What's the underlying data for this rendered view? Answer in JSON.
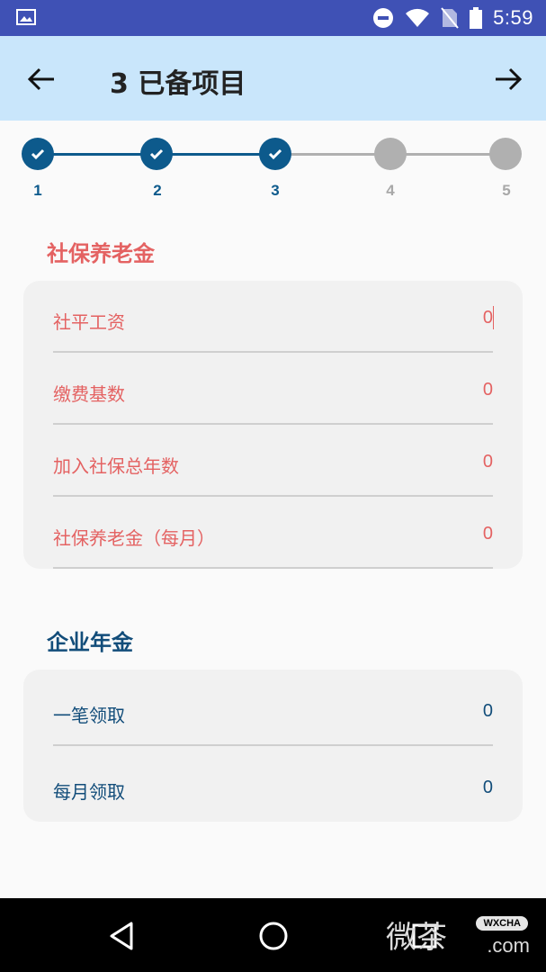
{
  "status_bar": {
    "time": "5:59",
    "icons": [
      "image-icon",
      "do-not-disturb-icon",
      "wifi-icon",
      "no-sim-icon",
      "battery-icon"
    ]
  },
  "app_bar": {
    "title": "3 已备项目",
    "back_icon": "arrow-left-icon",
    "forward_icon": "arrow-right-icon",
    "background": "#c9e6fb"
  },
  "stepper": {
    "current_step": 3,
    "steps": [
      {
        "label": "1",
        "state": "done"
      },
      {
        "label": "2",
        "state": "done"
      },
      {
        "label": "3",
        "state": "done"
      },
      {
        "label": "4",
        "state": "todo"
      },
      {
        "label": "5",
        "state": "todo"
      }
    ],
    "done_color": "#0d5a8c",
    "todo_color": "#b0b0b0"
  },
  "social_security": {
    "title": "社保养老金",
    "title_color": "#e46262",
    "fields": [
      {
        "label": "社平工资",
        "value": "0"
      },
      {
        "label": "缴费基数",
        "value": "0"
      },
      {
        "label": "加入社保总年数",
        "value": "0"
      },
      {
        "label": "社保养老金（每月）",
        "value": "0"
      }
    ]
  },
  "enterprise_annuity": {
    "title": "企业年金",
    "title_color": "#124d7a",
    "fields": [
      {
        "label": "一笔领取",
        "value": "0"
      },
      {
        "label": "每月领取",
        "value": "0"
      }
    ]
  },
  "nav_bar": {
    "icons": [
      "back-triangle-icon",
      "home-circle-icon",
      "recents-square-icon"
    ]
  },
  "watermark": {
    "text": "微茶",
    "badge": "WXCHA",
    "domain": ".com"
  }
}
